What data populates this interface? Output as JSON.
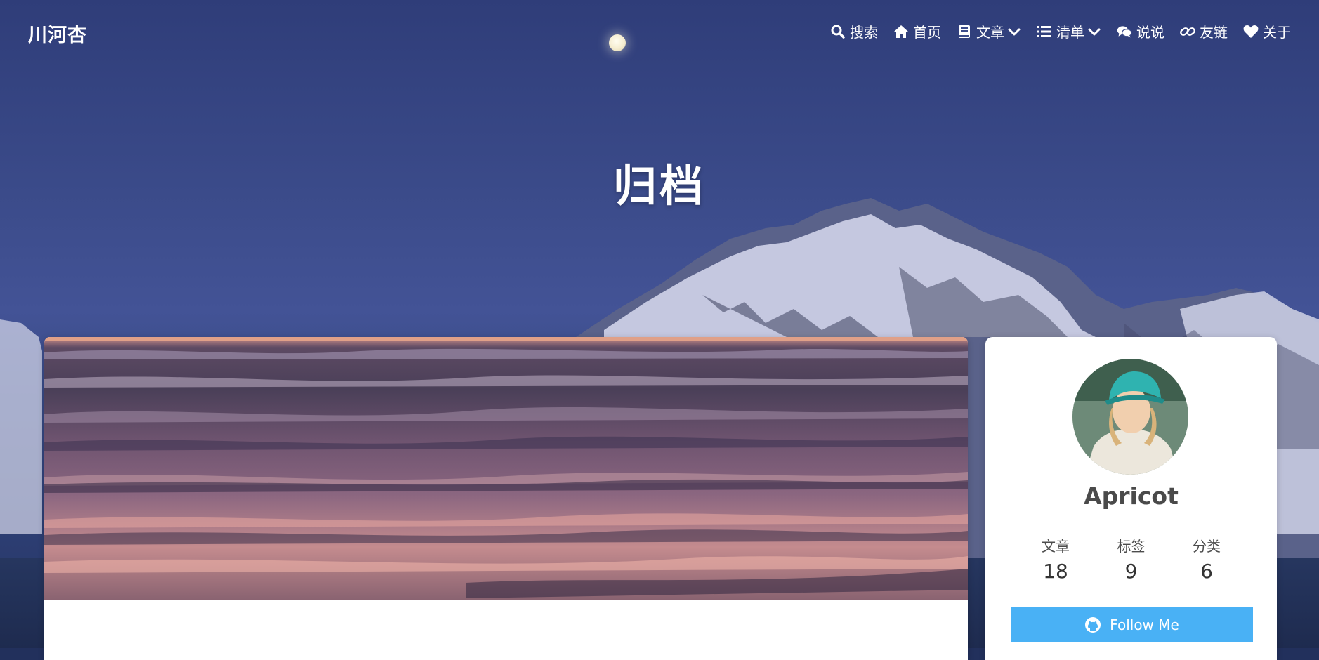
{
  "site": {
    "brand": "川河杏"
  },
  "nav": {
    "items": [
      {
        "label": "搜索",
        "icon": "search-icon"
      },
      {
        "label": "首页",
        "icon": "home-icon"
      },
      {
        "label": "文章",
        "icon": "book-icon",
        "dropdown": true
      },
      {
        "label": "清单",
        "icon": "list-icon",
        "dropdown": true
      },
      {
        "label": "说说",
        "icon": "comments-icon"
      },
      {
        "label": "友链",
        "icon": "link-icon"
      },
      {
        "label": "关于",
        "icon": "heart-icon"
      }
    ]
  },
  "hero": {
    "title": "归档"
  },
  "profile": {
    "name": "Apricot",
    "stats": [
      {
        "label": "文章",
        "value": "18"
      },
      {
        "label": "标签",
        "value": "9"
      },
      {
        "label": "分类",
        "value": "6"
      }
    ],
    "follow_label": "Follow Me",
    "follow_icon": "github-icon"
  },
  "colors": {
    "accent": "#49b1f5",
    "sky": "#3b4b8a"
  }
}
